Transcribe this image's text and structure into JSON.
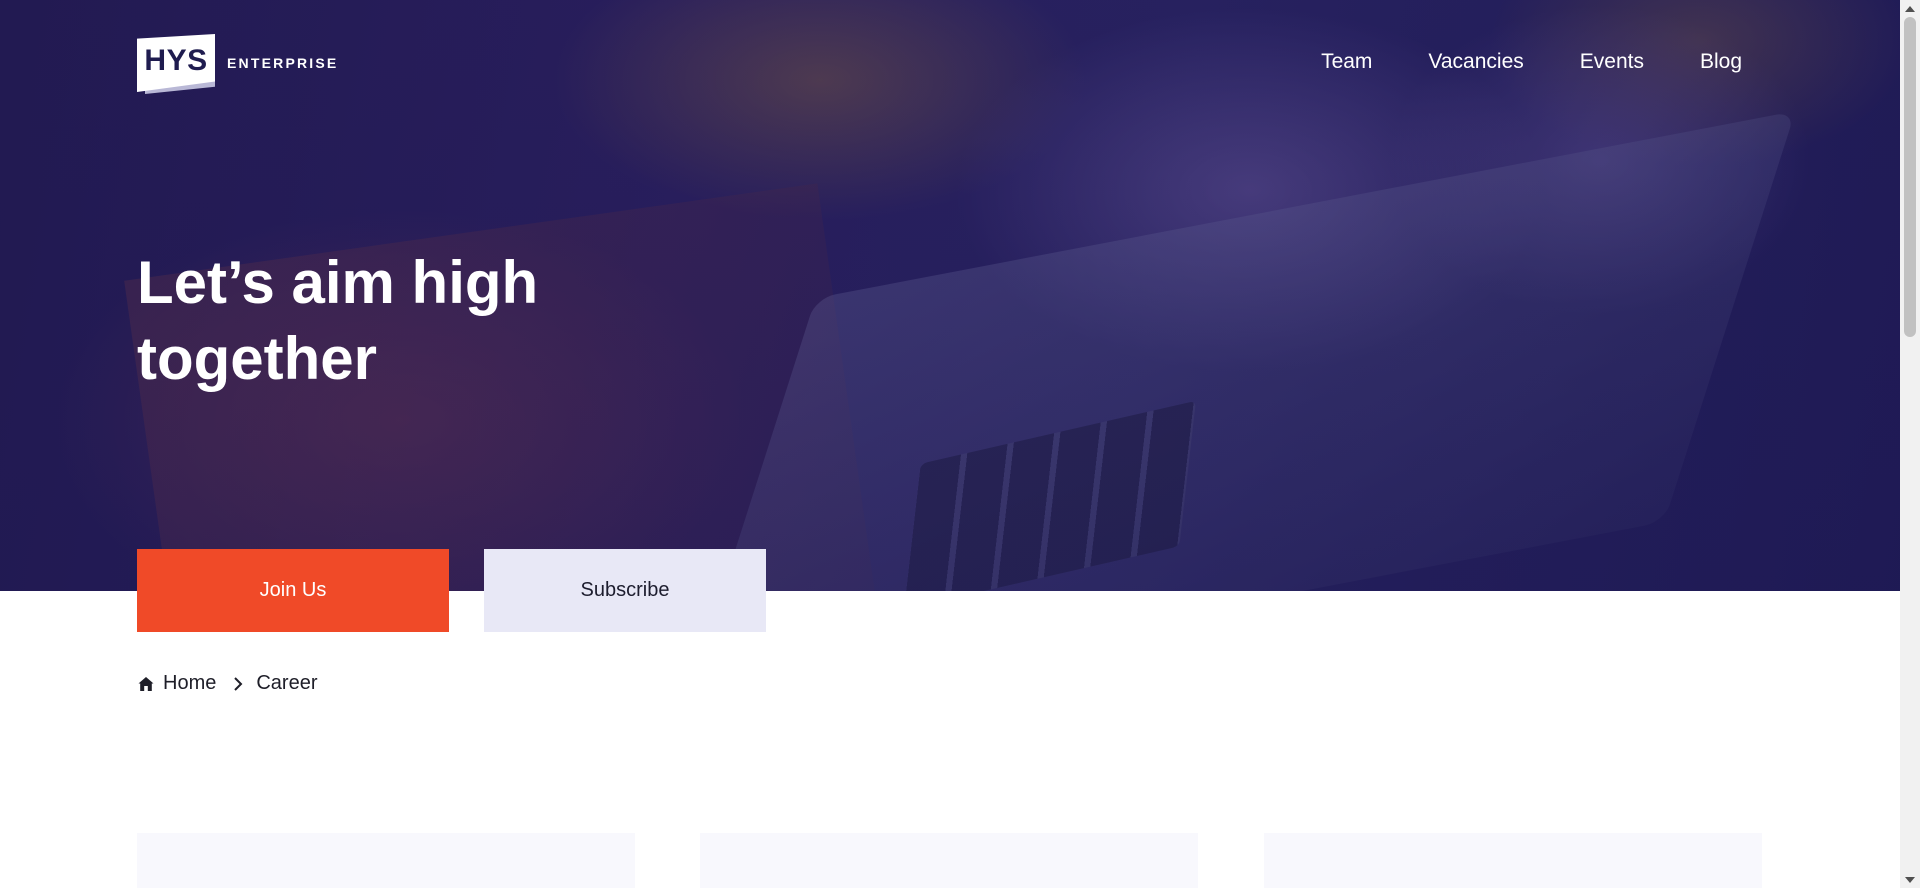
{
  "header": {
    "logo": {
      "mark": "HYS",
      "word": "ENTERPRISE"
    },
    "nav": [
      {
        "label": "Team"
      },
      {
        "label": "Vacancies"
      },
      {
        "label": "Events"
      },
      {
        "label": "Blog"
      }
    ]
  },
  "hero": {
    "headline": "Let’s aim high together",
    "buttons": {
      "join_label": "Join Us",
      "subscribe_label": "Subscribe"
    }
  },
  "breadcrumb": {
    "icon": "home-icon",
    "items": [
      {
        "label": "Home"
      },
      {
        "label": "Career"
      }
    ],
    "separator_icon": "chevron-right-icon"
  },
  "colors": {
    "primary_dark": "#241b52",
    "accent": "#f04a28",
    "secondary_button": "#e8e8f6",
    "card_bg": "#f8f8fd"
  }
}
